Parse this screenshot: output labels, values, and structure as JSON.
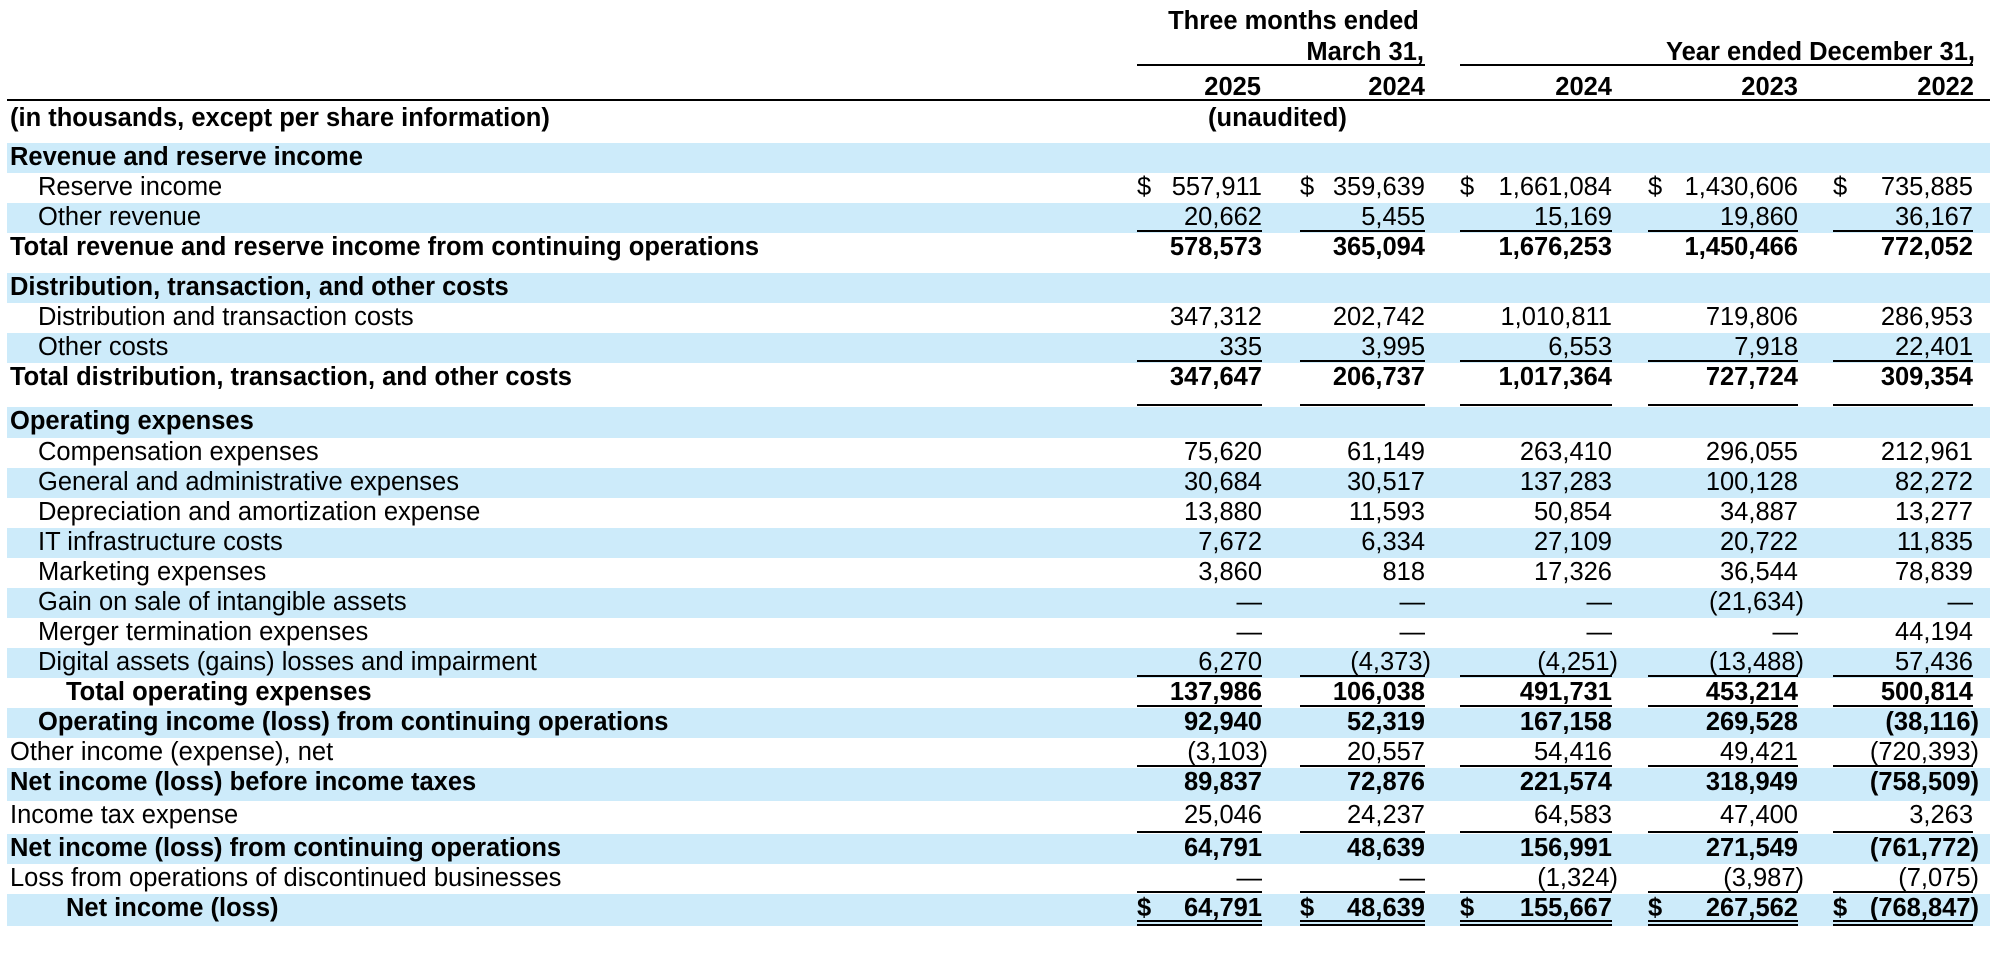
{
  "header": {
    "group1_line1": "Three months ended",
    "group1_line2": "March 31,",
    "group2_line1": "Year ended December 31,",
    "years": [
      "2025",
      "2024",
      "2024",
      "2023",
      "2022"
    ],
    "units_note": "(in thousands, except per share information)",
    "unaudited": "(unaudited)"
  },
  "rows": [
    {
      "label": "Revenue and reserve income",
      "bold": true,
      "indent": 0,
      "shade": true,
      "h": 30,
      "values": []
    },
    {
      "label": "Reserve income",
      "indent": 1,
      "h": 30,
      "values": [
        {
          "v": "557,911",
          "dollar": true
        },
        {
          "v": "359,639",
          "dollar": true
        },
        {
          "v": "1,661,084",
          "dollar": true
        },
        {
          "v": "1,430,606",
          "dollar": true
        },
        {
          "v": "735,885",
          "dollar": true
        }
      ]
    },
    {
      "label": "Other revenue",
      "indent": 1,
      "shade": true,
      "h": 30,
      "values": [
        {
          "v": "20,662",
          "ul": 1
        },
        {
          "v": "5,455",
          "ul": 1
        },
        {
          "v": "15,169",
          "ul": 1
        },
        {
          "v": "19,860",
          "ul": 1
        },
        {
          "v": "36,167",
          "ul": 1
        }
      ]
    },
    {
      "label": "Total revenue and reserve income from continuing operations",
      "bold": true,
      "indent": 0,
      "h": 40,
      "values": [
        {
          "v": "578,573"
        },
        {
          "v": "365,094"
        },
        {
          "v": "1,676,253"
        },
        {
          "v": "1,450,466"
        },
        {
          "v": "772,052"
        }
      ]
    },
    {
      "label": "Distribution, transaction, and other costs",
      "bold": true,
      "indent": 0,
      "shade": true,
      "h": 30,
      "values": []
    },
    {
      "label": "Distribution and transaction costs",
      "indent": 1,
      "h": 30,
      "values": [
        {
          "v": "347,312"
        },
        {
          "v": "202,742"
        },
        {
          "v": "1,010,811"
        },
        {
          "v": "719,806"
        },
        {
          "v": "286,953"
        }
      ]
    },
    {
      "label": "Other costs",
      "indent": 1,
      "shade": true,
      "h": 30,
      "values": [
        {
          "v": "335",
          "ul": 1
        },
        {
          "v": "3,995",
          "ul": 1
        },
        {
          "v": "6,553",
          "ul": 1
        },
        {
          "v": "7,918",
          "ul": 1
        },
        {
          "v": "22,401",
          "ul": 1
        }
      ]
    },
    {
      "label": "Total distribution, transaction, and other costs",
      "bold": true,
      "indent": 0,
      "h": 44,
      "values": [
        {
          "v": "347,647",
          "ul": 1
        },
        {
          "v": "206,737",
          "ul": 1
        },
        {
          "v": "1,017,364",
          "ul": 1
        },
        {
          "v": "727,724",
          "ul": 1
        },
        {
          "v": "309,354",
          "ul": 1
        }
      ]
    },
    {
      "label": "Operating expenses",
      "bold": true,
      "indent": 0,
      "shade": true,
      "h": 31,
      "values": []
    },
    {
      "label": "Compensation expenses",
      "indent": 1,
      "h": 30,
      "values": [
        {
          "v": "75,620"
        },
        {
          "v": "61,149"
        },
        {
          "v": "263,410"
        },
        {
          "v": "296,055"
        },
        {
          "v": "212,961"
        }
      ]
    },
    {
      "label": "General and administrative expenses",
      "indent": 1,
      "shade": true,
      "h": 30,
      "values": [
        {
          "v": "30,684"
        },
        {
          "v": "30,517"
        },
        {
          "v": "137,283"
        },
        {
          "v": "100,128"
        },
        {
          "v": "82,272"
        }
      ]
    },
    {
      "label": "Depreciation and amortization expense",
      "indent": 1,
      "h": 30,
      "values": [
        {
          "v": "13,880"
        },
        {
          "v": "11,593"
        },
        {
          "v": "50,854"
        },
        {
          "v": "34,887"
        },
        {
          "v": "13,277"
        }
      ]
    },
    {
      "label": "IT infrastructure costs",
      "indent": 1,
      "shade": true,
      "h": 30,
      "values": [
        {
          "v": "7,672"
        },
        {
          "v": "6,334"
        },
        {
          "v": "27,109"
        },
        {
          "v": "20,722"
        },
        {
          "v": "11,835"
        }
      ]
    },
    {
      "label": "Marketing expenses",
      "indent": 1,
      "h": 30,
      "values": [
        {
          "v": "3,860"
        },
        {
          "v": "818"
        },
        {
          "v": "17,326"
        },
        {
          "v": "36,544"
        },
        {
          "v": "78,839"
        }
      ]
    },
    {
      "label": "Gain on sale of intangible assets",
      "indent": 1,
      "shade": true,
      "h": 30,
      "values": [
        {
          "v": "—"
        },
        {
          "v": "—"
        },
        {
          "v": "—"
        },
        {
          "v": "(21,634)",
          "paren": true
        },
        {
          "v": "—"
        }
      ]
    },
    {
      "label": "Merger termination expenses",
      "indent": 1,
      "h": 30,
      "values": [
        {
          "v": "—"
        },
        {
          "v": "—"
        },
        {
          "v": "—"
        },
        {
          "v": "—"
        },
        {
          "v": "44,194"
        }
      ]
    },
    {
      "label": "Digital assets (gains) losses and impairment",
      "indent": 1,
      "shade": true,
      "h": 30,
      "values": [
        {
          "v": "6,270",
          "ul": 1
        },
        {
          "v": "(4,373)",
          "ul": 1,
          "paren": true
        },
        {
          "v": "(4,251)",
          "ul": 1,
          "paren": true
        },
        {
          "v": "(13,488)",
          "ul": 1,
          "paren": true
        },
        {
          "v": "57,436",
          "ul": 1
        }
      ]
    },
    {
      "label": "Total operating expenses",
      "bold": true,
      "indent": 2,
      "h": 30,
      "values": [
        {
          "v": "137,986",
          "ul": 1
        },
        {
          "v": "106,038",
          "ul": 1
        },
        {
          "v": "491,731",
          "ul": 1
        },
        {
          "v": "453,214",
          "ul": 1
        },
        {
          "v": "500,814",
          "ul": 1
        }
      ]
    },
    {
      "label": "Operating income (loss) from continuing operations",
      "bold": true,
      "indent": 1,
      "shade": true,
      "h": 30,
      "values": [
        {
          "v": "92,940"
        },
        {
          "v": "52,319"
        },
        {
          "v": "167,158"
        },
        {
          "v": "269,528"
        },
        {
          "v": "(38,116)",
          "paren": true
        }
      ]
    },
    {
      "label": "Other income (expense), net",
      "indent": 0,
      "h": 30,
      "values": [
        {
          "v": "(3,103)",
          "ul": 1,
          "paren": true
        },
        {
          "v": "20,557",
          "ul": 1
        },
        {
          "v": "54,416",
          "ul": 1
        },
        {
          "v": "49,421",
          "ul": 1
        },
        {
          "v": "(720,393)",
          "ul": 1,
          "paren": true
        }
      ]
    },
    {
      "label": "Net income (loss) before income taxes",
      "bold": true,
      "indent": 0,
      "shade": true,
      "h": 33,
      "values": [
        {
          "v": "89,837"
        },
        {
          "v": "72,876"
        },
        {
          "v": "221,574"
        },
        {
          "v": "318,949"
        },
        {
          "v": "(758,509)",
          "paren": true
        }
      ]
    },
    {
      "label": "Income tax expense",
      "indent": 0,
      "h": 33,
      "values": [
        {
          "v": "25,046",
          "ul": 1
        },
        {
          "v": "24,237",
          "ul": 1
        },
        {
          "v": "64,583",
          "ul": 1
        },
        {
          "v": "47,400",
          "ul": 1
        },
        {
          "v": "3,263",
          "ul": 1
        }
      ]
    },
    {
      "label": "Net income (loss) from continuing operations",
      "bold": true,
      "indent": 0,
      "shade": true,
      "h": 30,
      "values": [
        {
          "v": "64,791"
        },
        {
          "v": "48,639"
        },
        {
          "v": "156,991"
        },
        {
          "v": "271,549"
        },
        {
          "v": "(761,772)",
          "paren": true
        }
      ]
    },
    {
      "label": "Loss from operations of discontinued businesses",
      "indent": 0,
      "h": 30,
      "values": [
        {
          "v": "—",
          "ul": 1
        },
        {
          "v": "—",
          "ul": 1
        },
        {
          "v": "(1,324)",
          "ul": 1,
          "paren": true
        },
        {
          "v": "(3,987)",
          "ul": 1,
          "paren": true
        },
        {
          "v": "(7,075)",
          "ul": 1,
          "paren": true
        }
      ]
    },
    {
      "label": "Net income (loss)",
      "bold": true,
      "indent": 2,
      "shade": true,
      "h": 32,
      "values": [
        {
          "v": "64,791",
          "dollar": true,
          "ul": 2
        },
        {
          "v": "48,639",
          "dollar": true,
          "ul": 2
        },
        {
          "v": "155,667",
          "dollar": true,
          "ul": 2
        },
        {
          "v": "267,562",
          "dollar": true,
          "ul": 2
        },
        {
          "v": "(768,847)",
          "dollar": true,
          "ul": 2,
          "paren": true
        }
      ]
    }
  ]
}
